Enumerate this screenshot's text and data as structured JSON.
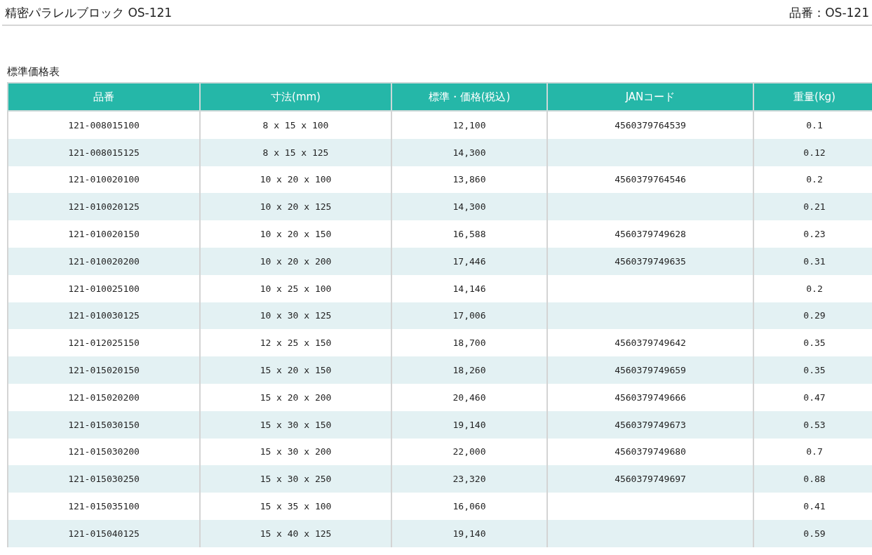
{
  "page_title": "精密パラレルブロック OS-121",
  "part_number": "品番：OS-121",
  "section_title": "標準価格表",
  "table": {
    "columns": [
      "品番",
      "寸法(mm)",
      "標準・価格(税込)",
      "JANコード",
      "重量(kg)"
    ],
    "rows": [
      {
        "part": "121-008015100",
        "size": "8 x 15 x 100",
        "price": "12,100",
        "jan": "4560379764539",
        "weight": "0.1"
      },
      {
        "part": "121-008015125",
        "size": "8 x 15 x 125",
        "price": "14,300",
        "weight": "0.12"
      },
      {
        "part": "121-010020100",
        "size": "10 x 20 x 100",
        "price": "13,860",
        "jan": "4560379764546",
        "weight": "0.2"
      },
      {
        "part": "121-010020125",
        "size": "10 x 20 x 125",
        "price": "14,300",
        "weight": "0.21"
      },
      {
        "part": "121-010020150",
        "size": "10 x 20 x 150",
        "price": "16,588",
        "jan": "4560379749628",
        "weight": "0.23"
      },
      {
        "part": "121-010020200",
        "size": "10 x 20 x 200",
        "price": "17,446",
        "jan": "4560379749635",
        "weight": "0.31"
      },
      {
        "part": "121-010025100",
        "size": "10 x 25 x 100",
        "price": "14,146",
        "weight": "0.2"
      },
      {
        "part": "121-010030125",
        "size": "10 x 30 x 125",
        "price": "17,006",
        "weight": "0.29"
      },
      {
        "part": "121-012025150",
        "size": "12 x 25 x 150",
        "price": "18,700",
        "jan": "4560379749642",
        "weight": "0.35"
      },
      {
        "part": "121-015020150",
        "size": "15 x 20 x 150",
        "price": "18,260",
        "jan": "4560379749659",
        "weight": "0.35"
      },
      {
        "part": "121-015020200",
        "size": "15 x 20 x 200",
        "price": "20,460",
        "jan": "4560379749666",
        "weight": "0.47"
      },
      {
        "part": "121-015030150",
        "size": "15 x 30 x 150",
        "price": "19,140",
        "jan": "4560379749673",
        "weight": "0.53"
      },
      {
        "part": "121-015030200",
        "size": "15 x 30 x 200",
        "price": "22,000",
        "jan": "4560379749680",
        "weight": "0.7"
      },
      {
        "part": "121-015030250",
        "size": "15 x 30 x 250",
        "price": "23,320",
        "jan": "4560379749697",
        "weight": "0.88"
      },
      {
        "part": "121-015035100",
        "size": "15 x 35 x 100",
        "price": "16,060",
        "weight": "0.41"
      },
      {
        "part": "121-015040125",
        "size": "15 x 40 x 125",
        "price": "19,140",
        "weight": "0.59"
      }
    ]
  }
}
